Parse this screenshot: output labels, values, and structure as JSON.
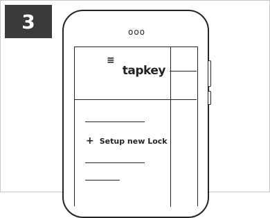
{
  "step": {
    "number": "3"
  },
  "phone": {
    "speaker": "ooo",
    "brand": "tapkey",
    "menu_icon": "≡",
    "menu_items": [
      {
        "icon": "plus-icon",
        "icon_glyph": "+",
        "label": "Setup new Lock"
      }
    ]
  },
  "colors": {
    "badge_bg": "#3a3a3a",
    "line": "#222222",
    "frame_border": "#c8c8c8"
  }
}
